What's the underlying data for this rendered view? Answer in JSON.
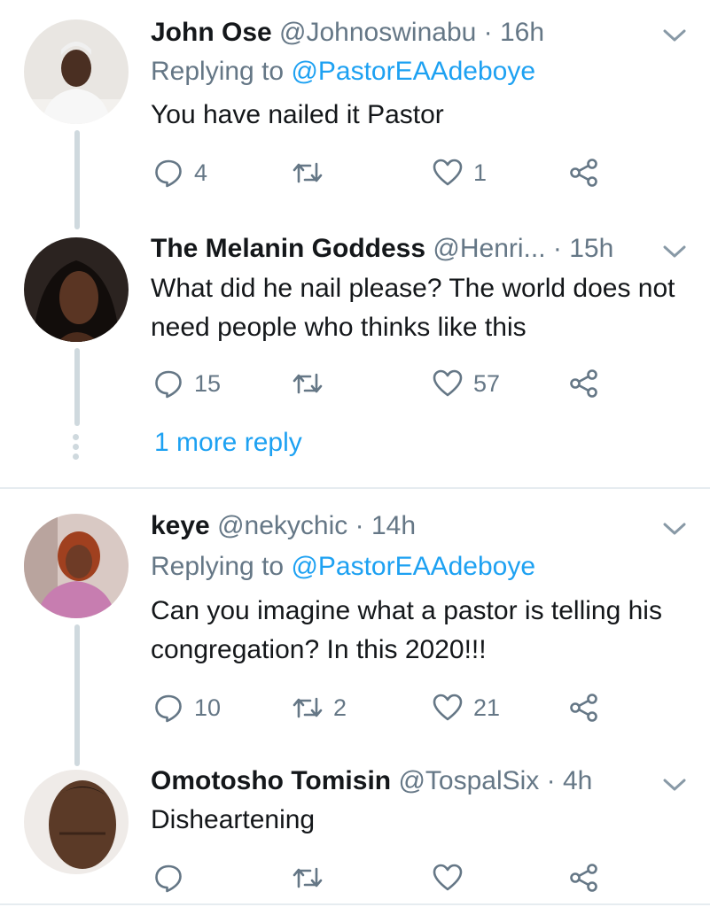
{
  "colors": {
    "accent": "#1da1f2",
    "muted": "#657786",
    "text": "#14171a",
    "divider": "#e6ecf0"
  },
  "tweets": [
    {
      "name": "John Ose",
      "handle": "@Johnoswinabu",
      "time": "· 16h",
      "replying_label": "Replying to",
      "replying_to": "@PastorEAAdeboye",
      "text": "You have nailed it Pastor",
      "replies": "4",
      "retweets": "",
      "likes": "1"
    },
    {
      "name": "The Melanin Goddess",
      "handle": "@Henri...",
      "time": "· 15h",
      "text": "What did he nail please?  The world does not need people who thinks like this",
      "replies": "15",
      "retweets": "",
      "likes": "57",
      "more_replies": "1 more reply"
    },
    {
      "name": "keye",
      "handle": "@nekychic",
      "time": "· 14h",
      "replying_label": "Replying to",
      "replying_to": "@PastorEAAdeboye",
      "text": "Can you imagine what a pastor is telling his congregation? In this 2020!!!",
      "replies": "10",
      "retweets": "2",
      "likes": "21"
    },
    {
      "name": "Omotosho Tomisin",
      "handle": "@TospalSix",
      "time": "· 4h",
      "text": "Disheartening",
      "replies": "",
      "retweets": "",
      "likes": ""
    }
  ],
  "icons": {
    "reply": "reply-icon",
    "retweet": "retweet-icon",
    "like": "heart-icon",
    "share": "share-icon",
    "caret": "chevron-down-icon"
  }
}
